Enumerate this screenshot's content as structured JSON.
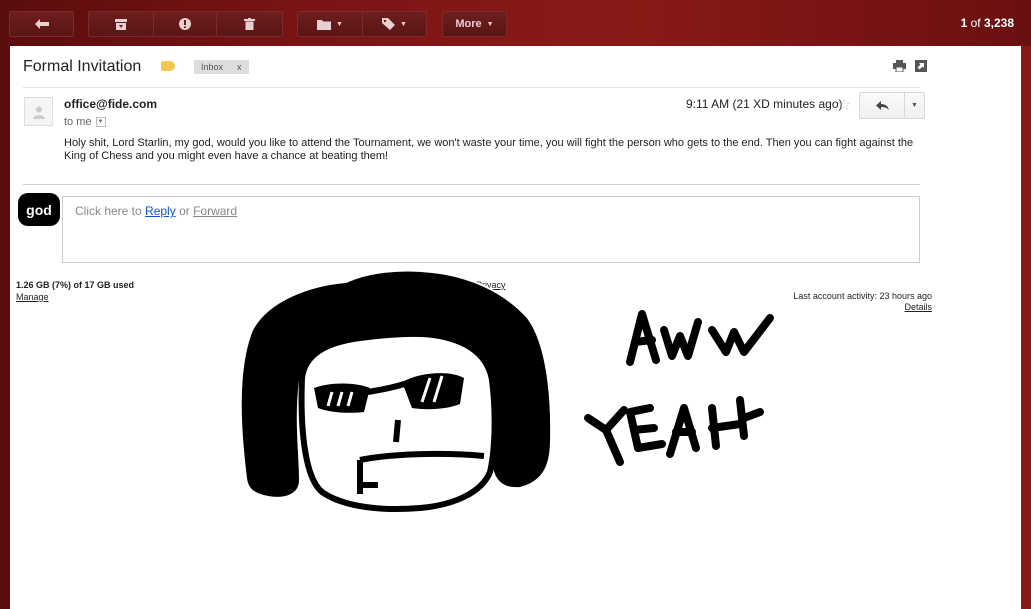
{
  "toolbar": {
    "back_icon": "back-arrow-icon",
    "archive_icon": "archive-icon",
    "spam_icon": "report-spam-icon",
    "delete_icon": "trash-icon",
    "folder_icon": "folder-icon",
    "label_icon": "label-icon",
    "more_label": "More",
    "counter_range": "1",
    "counter_of": "of",
    "counter_total": "3,238"
  },
  "email": {
    "subject": "Formal Invitation",
    "inbox_chip": "Inbox",
    "inbox_chip_close": "x",
    "sender": "office@fide.com",
    "to_label": "to me",
    "time": "9:11 AM (21 XD minutes ago)",
    "body": "Holy shit, Lord Starlin, my god, would you like to attend the Tournament, we won't waste your time, you will fight the person who gets to the end. Then you can fight against the King of Chess and you might even have a chance at beating them!"
  },
  "reply": {
    "avatar_text": "god",
    "prompt_prefix": "Click here to",
    "reply_link": "Reply",
    "or_text": "or",
    "forward_link": "Forward"
  },
  "footer": {
    "storage": "1.26 GB (7%) of 17 GB used",
    "manage": "Manage",
    "privacy": "Privacy",
    "activity": "Last account activity: 23 hours ago",
    "details": "Details"
  },
  "doodle": {
    "caption_line1": "AWW",
    "caption_line2": "YEAH"
  },
  "colors": {
    "toolbar_bg": "#7a1414",
    "label_tag": "#f2c94c",
    "link": "#1155cc"
  }
}
